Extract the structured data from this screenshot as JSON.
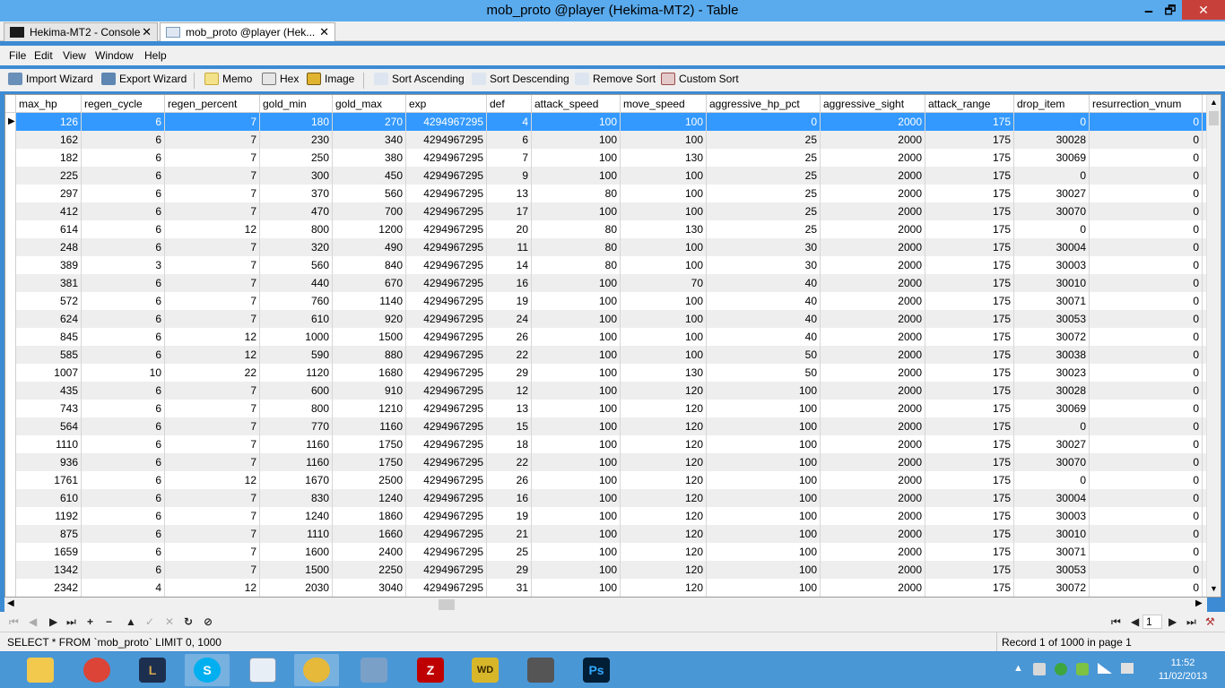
{
  "window": {
    "title": "mob_proto @player (Hekima-MT2) - Table",
    "minimize": "🗕",
    "maximize": "🗗",
    "close": "✕"
  },
  "tabs": [
    {
      "label": "Hekima-MT2 - Console",
      "close": "✕"
    },
    {
      "label": "mob_proto @player (Hek...",
      "close": "✕"
    }
  ],
  "menu": [
    "File",
    "Edit",
    "View",
    "Window",
    "Help"
  ],
  "toolbar": {
    "import_wizard": "Import Wizard",
    "export_wizard": "Export Wizard",
    "memo": "Memo",
    "hex": "Hex",
    "image": "Image",
    "sort_ascending": "Sort Ascending",
    "sort_descending": "Sort Descending",
    "remove_sort": "Remove Sort",
    "custom_sort": "Custom Sort"
  },
  "table": {
    "columns": [
      "max_hp",
      "regen_cycle",
      "regen_percent",
      "gold_min",
      "gold_max",
      "exp",
      "def",
      "attack_speed",
      "move_speed",
      "aggressive_hp_pct",
      "aggressive_sight",
      "attack_range",
      "drop_item",
      "resurrection_vnum"
    ],
    "rows": [
      [
        126,
        6,
        7,
        180,
        270,
        4294967295,
        4,
        100,
        100,
        0,
        2000,
        175,
        0,
        0
      ],
      [
        162,
        6,
        7,
        230,
        340,
        4294967295,
        6,
        100,
        100,
        25,
        2000,
        175,
        30028,
        0
      ],
      [
        182,
        6,
        7,
        250,
        380,
        4294967295,
        7,
        100,
        130,
        25,
        2000,
        175,
        30069,
        0
      ],
      [
        225,
        6,
        7,
        300,
        450,
        4294967295,
        9,
        100,
        100,
        25,
        2000,
        175,
        0,
        0
      ],
      [
        297,
        6,
        7,
        370,
        560,
        4294967295,
        13,
        80,
        100,
        25,
        2000,
        175,
        30027,
        0
      ],
      [
        412,
        6,
        7,
        470,
        700,
        4294967295,
        17,
        100,
        100,
        25,
        2000,
        175,
        30070,
        0
      ],
      [
        614,
        6,
        12,
        800,
        1200,
        4294967295,
        20,
        80,
        130,
        25,
        2000,
        175,
        0,
        0
      ],
      [
        248,
        6,
        7,
        320,
        490,
        4294967295,
        11,
        80,
        100,
        30,
        2000,
        175,
        30004,
        0
      ],
      [
        389,
        3,
        7,
        560,
        840,
        4294967295,
        14,
        80,
        100,
        30,
        2000,
        175,
        30003,
        0
      ],
      [
        381,
        6,
        7,
        440,
        670,
        4294967295,
        16,
        100,
        70,
        40,
        2000,
        175,
        30010,
        0
      ],
      [
        572,
        6,
        7,
        760,
        1140,
        4294967295,
        19,
        100,
        100,
        40,
        2000,
        175,
        30071,
        0
      ],
      [
        624,
        6,
        7,
        610,
        920,
        4294967295,
        24,
        100,
        100,
        40,
        2000,
        175,
        30053,
        0
      ],
      [
        845,
        6,
        12,
        1000,
        1500,
        4294967295,
        26,
        100,
        100,
        40,
        2000,
        175,
        30072,
        0
      ],
      [
        585,
        6,
        12,
        590,
        880,
        4294967295,
        22,
        100,
        100,
        50,
        2000,
        175,
        30038,
        0
      ],
      [
        1007,
        10,
        22,
        1120,
        1680,
        4294967295,
        29,
        100,
        130,
        50,
        2000,
        175,
        30023,
        0
      ],
      [
        435,
        6,
        7,
        600,
        910,
        4294967295,
        12,
        100,
        120,
        100,
        2000,
        175,
        30028,
        0
      ],
      [
        743,
        6,
        7,
        800,
        1210,
        4294967295,
        13,
        100,
        120,
        100,
        2000,
        175,
        30069,
        0
      ],
      [
        564,
        6,
        7,
        770,
        1160,
        4294967295,
        15,
        100,
        120,
        100,
        2000,
        175,
        0,
        0
      ],
      [
        1110,
        6,
        7,
        1160,
        1750,
        4294967295,
        18,
        100,
        120,
        100,
        2000,
        175,
        30027,
        0
      ],
      [
        936,
        6,
        7,
        1160,
        1750,
        4294967295,
        22,
        100,
        120,
        100,
        2000,
        175,
        30070,
        0
      ],
      [
        1761,
        6,
        12,
        1670,
        2500,
        4294967295,
        26,
        100,
        120,
        100,
        2000,
        175,
        0,
        0
      ],
      [
        610,
        6,
        7,
        830,
        1240,
        4294967295,
        16,
        100,
        120,
        100,
        2000,
        175,
        30004,
        0
      ],
      [
        1192,
        6,
        7,
        1240,
        1860,
        4294967295,
        19,
        100,
        120,
        100,
        2000,
        175,
        30003,
        0
      ],
      [
        875,
        6,
        7,
        1110,
        1660,
        4294967295,
        21,
        100,
        120,
        100,
        2000,
        175,
        30010,
        0
      ],
      [
        1659,
        6,
        7,
        1600,
        2400,
        4294967295,
        25,
        100,
        120,
        100,
        2000,
        175,
        30071,
        0
      ],
      [
        1342,
        6,
        7,
        1500,
        2250,
        4294967295,
        29,
        100,
        120,
        100,
        2000,
        175,
        30053,
        0
      ],
      [
        2342,
        4,
        12,
        2030,
        3040,
        4294967295,
        31,
        100,
        120,
        100,
        2000,
        175,
        30072,
        0
      ]
    ]
  },
  "navigation": {
    "first": "⏮",
    "prev": "◀",
    "next": "▶",
    "last": "⏭",
    "add": "+",
    "delete": "−",
    "up": "▲",
    "apply": "✓",
    "cancel": "✕",
    "refresh": "↻",
    "stop": "⊘",
    "page_first": "⏮",
    "page_prev": "◀",
    "page_number": "1",
    "page_next": "▶",
    "page_last": "⏭",
    "settings": "⚒"
  },
  "status": {
    "sql": "SELECT * FROM `mob_proto` LIMIT 0, 1000",
    "record": "Record 1 of 1000 in page 1"
  },
  "taskbar": {
    "time": "11:52",
    "date": "11/02/2013",
    "tray_arrow": "▲"
  },
  "colors": {
    "selection": "#3399ff",
    "close_button": "#c7413a",
    "taskbar": "#4a97d6"
  }
}
